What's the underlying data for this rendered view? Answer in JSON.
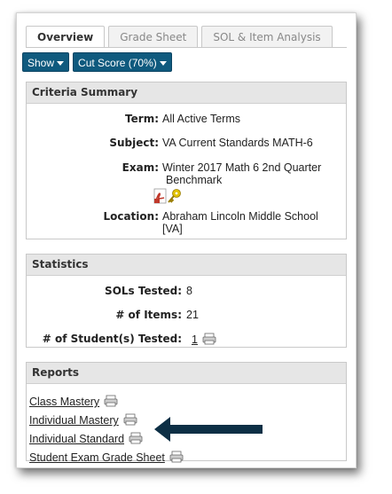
{
  "tabs": [
    {
      "label": "Overview",
      "active": true
    },
    {
      "label": "Grade Sheet",
      "active": false
    },
    {
      "label": "SOL & Item Analysis",
      "active": false
    }
  ],
  "toolbar": {
    "show_label": "Show",
    "cutscore_label": "Cut Score (70%)"
  },
  "criteria": {
    "heading": "Criteria Summary",
    "term_label": "Term:",
    "term_value": "All Active Terms",
    "subject_label": "Subject:",
    "subject_value": "VA Current Standards MATH-6",
    "exam_label": "Exam:",
    "exam_value_line1": "Winter 2017 Math 6 2nd Quarter",
    "exam_value_line2": "Benchmark",
    "location_label": "Location:",
    "location_value_line1": "Abraham Lincoln Middle School",
    "location_value_line2": "[VA]"
  },
  "statistics": {
    "heading": "Statistics",
    "sols_label": "SOLs Tested:",
    "sols_value": "8",
    "items_label": "# of Items:",
    "items_value": "21",
    "students_label": "# of Student(s) Tested:",
    "students_value": "1"
  },
  "reports": {
    "heading": "Reports",
    "items": [
      {
        "label": "Class Mastery"
      },
      {
        "label": "Individual Mastery"
      },
      {
        "label": "Individual Standard"
      },
      {
        "label": "Student Exam Grade Sheet"
      }
    ]
  },
  "colors": {
    "button": "#0f5a7e",
    "arrow": "#0d2f45",
    "pdf": "#c0392b",
    "key": "#e2c200"
  },
  "icons": [
    "caret-down-icon",
    "pdf-icon",
    "key-icon",
    "printer-icon",
    "arrow-left-icon"
  ]
}
